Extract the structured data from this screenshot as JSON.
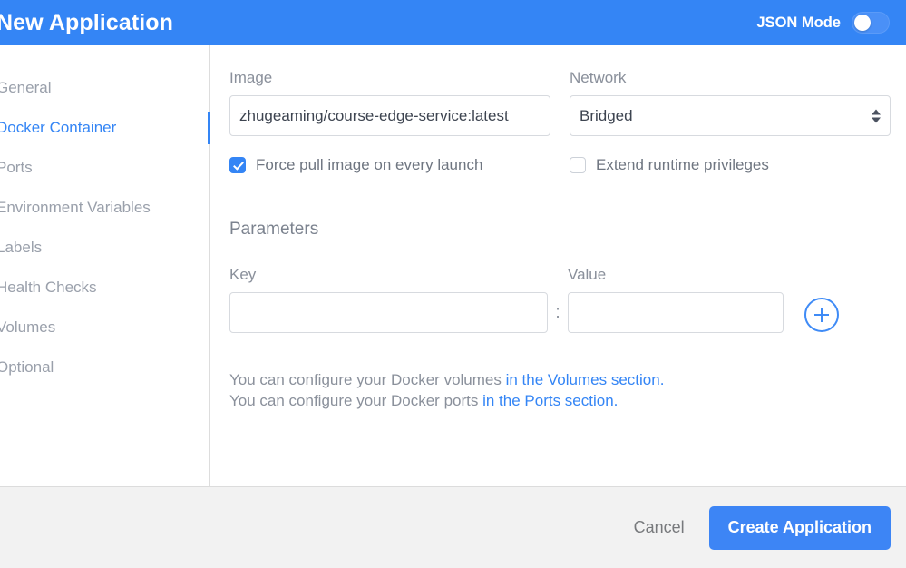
{
  "header": {
    "title": "New Application",
    "json_mode_label": "JSON Mode",
    "json_mode_state": "off",
    "accent_color": "#3485f5"
  },
  "sidebar": {
    "items": [
      {
        "label": "General",
        "active": false
      },
      {
        "label": "Docker Container",
        "active": true
      },
      {
        "label": "Ports",
        "active": false
      },
      {
        "label": "Environment Variables",
        "active": false
      },
      {
        "label": "Labels",
        "active": false
      },
      {
        "label": "Health Checks",
        "active": false
      },
      {
        "label": "Volumes",
        "active": false
      },
      {
        "label": "Optional",
        "active": false
      }
    ]
  },
  "form": {
    "image": {
      "label": "Image",
      "value": "zhugeaming/course-edge-service:latest",
      "placeholder": ""
    },
    "network": {
      "label": "Network",
      "selected": "Bridged"
    },
    "force_pull": {
      "label": "Force pull image on every launch",
      "checked": true
    },
    "extend_privileges": {
      "label": "Extend runtime privileges",
      "checked": false
    }
  },
  "parameters": {
    "section_title": "Parameters",
    "key_label": "Key",
    "value_label": "Value",
    "separator": ":",
    "key_value": "",
    "key_placeholder": "",
    "value_value": "",
    "value_placeholder": "",
    "add_button_icon": "plus-icon"
  },
  "help": {
    "line1_prefix": "You can configure your Docker volumes ",
    "line1_link": "in the Volumes section.",
    "line2_prefix": "You can configure your Docker ports ",
    "line2_link": "in the Ports section."
  },
  "footer": {
    "cancel_label": "Cancel",
    "create_label": "Create Application"
  }
}
